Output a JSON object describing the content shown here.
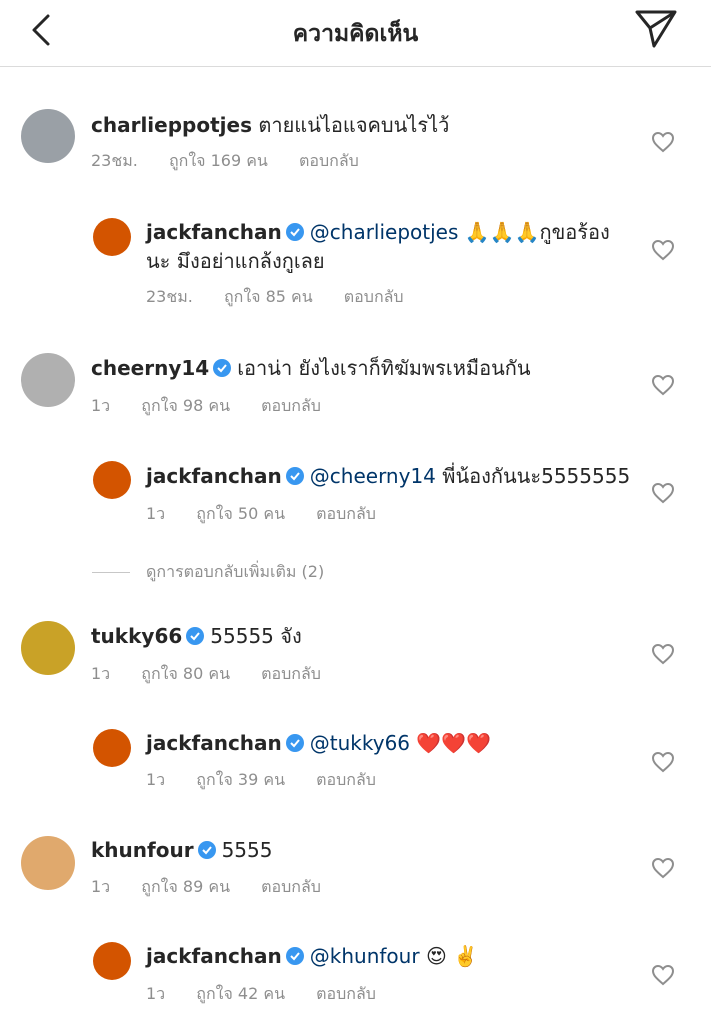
{
  "header": {
    "title": "ความคิดเห็น"
  },
  "comments": [
    {
      "user": "charlieppotjes",
      "text": "ตายแน่ไอแจคบนไรไว้",
      "time": "23ชม.",
      "likes": "ถูกใจ 169 คน",
      "reply": "ตอบกลับ"
    },
    {
      "user": "jackfanchan",
      "mention": "@charliepotjes",
      "emoji": "🙏🙏🙏",
      "text": "กูขอร้อง",
      "text2": "นะ มึงอย่าแกล้งกูเลย",
      "time": "23ชม.",
      "likes": "ถูกใจ 85 คน",
      "reply": "ตอบกลับ"
    },
    {
      "user": "cheerny14",
      "text": "เอาน่า ยังไงเราก็ทิฆัมพรเหมือนกัน",
      "time": "1ว",
      "likes": "ถูกใจ 98 คน",
      "reply": "ตอบกลับ"
    },
    {
      "user": "jackfanchan",
      "mention": "@cheerny14",
      "text": "พี่น้องกันนะ5555555",
      "time": "1ว",
      "likes": "ถูกใจ 50 คน",
      "reply": "ตอบกลับ"
    },
    {
      "user": "tukky66",
      "text": "55555 จัง",
      "time": "1ว",
      "likes": "ถูกใจ 80 คน",
      "reply": "ตอบกลับ"
    },
    {
      "user": "jackfanchan",
      "mention": "@tukky66",
      "emoji": "❤️❤️❤️",
      "time": "1ว",
      "likes": "ถูกใจ 39 คน",
      "reply": "ตอบกลับ"
    },
    {
      "user": "khunfour",
      "text": "5555",
      "time": "1ว",
      "likes": "ถูกใจ 89 คน",
      "reply": "ตอบกลับ"
    },
    {
      "user": "jackfanchan",
      "mention": "@khunfour",
      "emoji": "😍 ✌️",
      "time": "1ว",
      "likes": "ถูกใจ 42 คน",
      "reply": "ตอบกลับ"
    }
  ],
  "view_more": "ดูการตอบกลับเพิ่มเติม (2)",
  "colors": {
    "verified": "#3897f0",
    "mention": "#003569",
    "meta": "#8e8e8e"
  }
}
